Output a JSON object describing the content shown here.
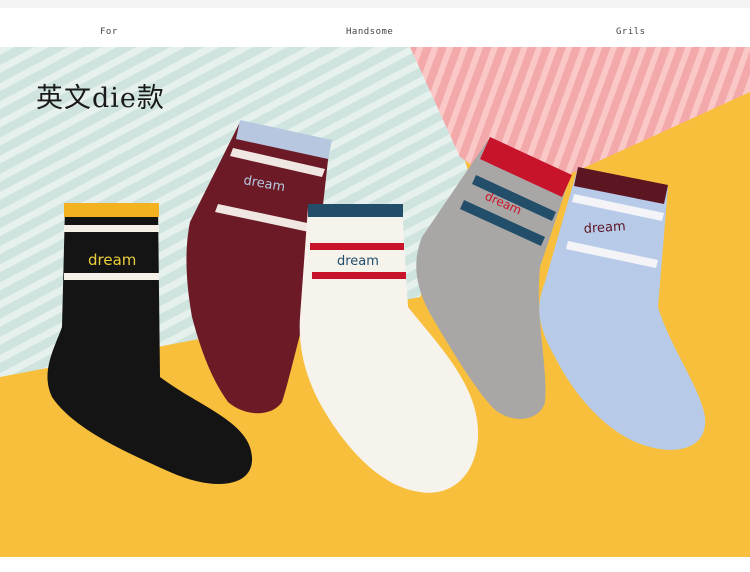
{
  "header": {
    "tag_left": "For",
    "tag_center": "Handsome",
    "tag_right": "Grils"
  },
  "photo": {
    "title": "英文die款",
    "sock_text": "dream",
    "colors": {
      "background": "#f7bf3c",
      "mint_panel": "#cfe3df",
      "pink_panel": "#f3a9aa"
    },
    "socks": [
      {
        "name": "black",
        "body": "#141414",
        "cuff_accent": "#f3b320",
        "text_color": "#e9cf3a"
      },
      {
        "name": "burgundy",
        "body": "#6b1a26",
        "cuff_accent": "#b7c7e0",
        "text_color": "#b7c7e0"
      },
      {
        "name": "cream",
        "body": "#f6f2ec",
        "cuff_accent": "#234e6a",
        "text_color": "#234e6a"
      },
      {
        "name": "grey",
        "body": "#a9a7a6",
        "cuff_accent": "#c8142a",
        "text_color": "#c8142a"
      },
      {
        "name": "light-blue",
        "body": "#b7cbe9",
        "cuff_accent": "#5c1622",
        "text_color": "#5c1622"
      }
    ]
  }
}
